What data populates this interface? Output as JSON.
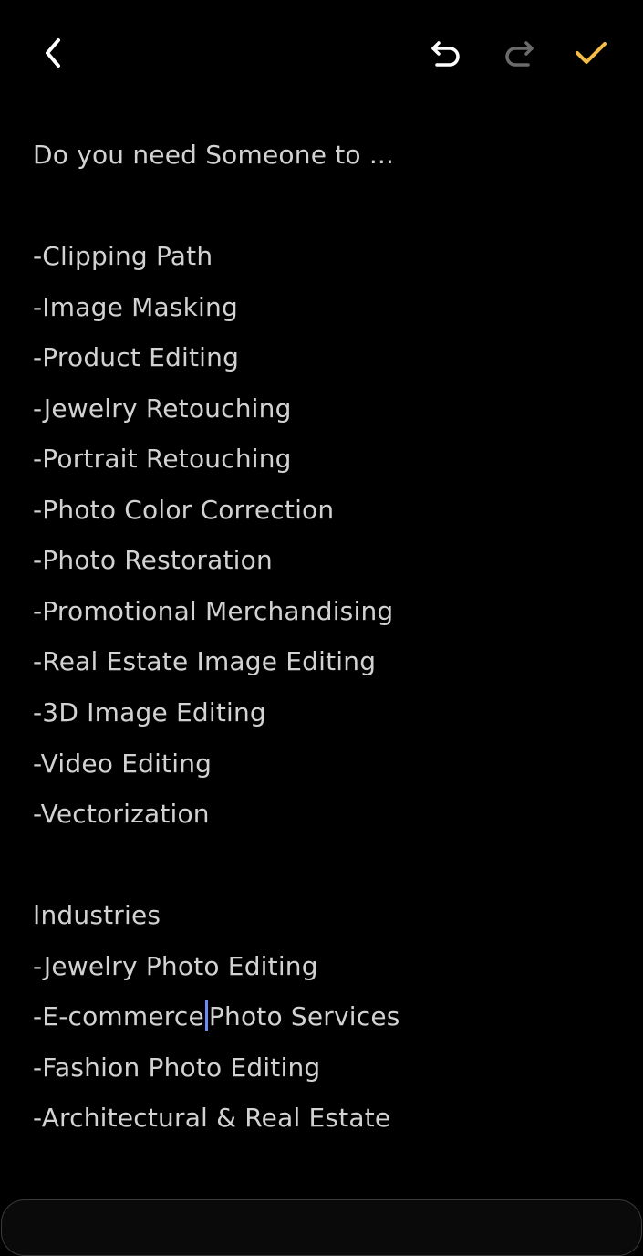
{
  "toolbar": {
    "back_icon": "chevron-left-icon",
    "undo_icon": "undo-icon",
    "redo_icon": "redo-icon",
    "done_icon": "check-icon",
    "colors": {
      "icon_active": "#ffffff",
      "icon_disabled": "#6b6b6b",
      "done": "#f4bc45"
    }
  },
  "note": {
    "intro": "Do you need Someone to ...",
    "services": [
      "-Clipping Path",
      "-Image Masking",
      "-Product Editing",
      "-Jewelry Retouching",
      "-Portrait Retouching",
      "-Photo Color Correction",
      "-Photo Restoration",
      "-Promotional Merchandising",
      "-Real Estate Image Editing",
      "-3D Image Editing",
      "-Video Editing",
      "-Vectorization"
    ],
    "industries_heading": "Industries",
    "industries": [
      "-Jewelry Photo Editing",
      "-E-commerce",
      "-Fashion Photo Editing",
      "-Architectural & Real Estate"
    ],
    "industries_line2_after_caret": "Photo Services",
    "caret_color": "#6e8cf5"
  }
}
